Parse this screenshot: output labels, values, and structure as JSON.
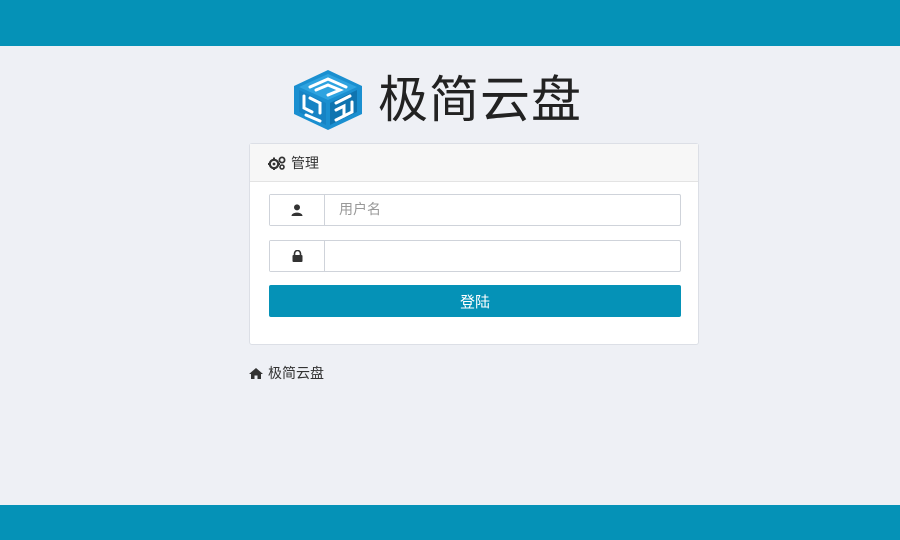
{
  "brand": {
    "name": "极简云盘"
  },
  "panel": {
    "title": "管理"
  },
  "form": {
    "username_placeholder": "用户名",
    "password_placeholder": "",
    "login_label": "登陆"
  },
  "footer": {
    "home_link": "极简云盘"
  },
  "colors": {
    "primary": "#0592b7",
    "background": "#eef0f5",
    "logo_blue": "#1a8fd0"
  }
}
